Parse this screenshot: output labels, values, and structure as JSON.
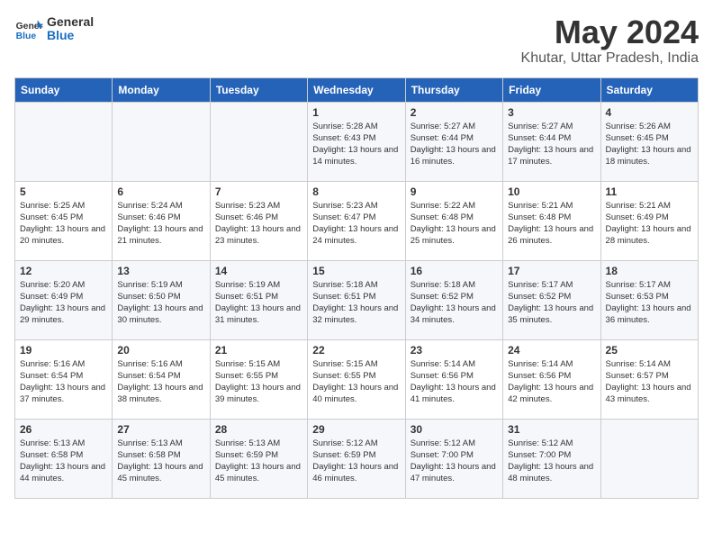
{
  "logo": {
    "text_general": "General",
    "text_blue": "Blue"
  },
  "title": "May 2024",
  "location": "Khutar, Uttar Pradesh, India",
  "headers": [
    "Sunday",
    "Monday",
    "Tuesday",
    "Wednesday",
    "Thursday",
    "Friday",
    "Saturday"
  ],
  "weeks": [
    [
      {
        "day": "",
        "info": ""
      },
      {
        "day": "",
        "info": ""
      },
      {
        "day": "",
        "info": ""
      },
      {
        "day": "1",
        "info": "Sunrise: 5:28 AM\nSunset: 6:43 PM\nDaylight: 13 hours and 14 minutes."
      },
      {
        "day": "2",
        "info": "Sunrise: 5:27 AM\nSunset: 6:44 PM\nDaylight: 13 hours and 16 minutes."
      },
      {
        "day": "3",
        "info": "Sunrise: 5:27 AM\nSunset: 6:44 PM\nDaylight: 13 hours and 17 minutes."
      },
      {
        "day": "4",
        "info": "Sunrise: 5:26 AM\nSunset: 6:45 PM\nDaylight: 13 hours and 18 minutes."
      }
    ],
    [
      {
        "day": "5",
        "info": "Sunrise: 5:25 AM\nSunset: 6:45 PM\nDaylight: 13 hours and 20 minutes."
      },
      {
        "day": "6",
        "info": "Sunrise: 5:24 AM\nSunset: 6:46 PM\nDaylight: 13 hours and 21 minutes."
      },
      {
        "day": "7",
        "info": "Sunrise: 5:23 AM\nSunset: 6:46 PM\nDaylight: 13 hours and 23 minutes."
      },
      {
        "day": "8",
        "info": "Sunrise: 5:23 AM\nSunset: 6:47 PM\nDaylight: 13 hours and 24 minutes."
      },
      {
        "day": "9",
        "info": "Sunrise: 5:22 AM\nSunset: 6:48 PM\nDaylight: 13 hours and 25 minutes."
      },
      {
        "day": "10",
        "info": "Sunrise: 5:21 AM\nSunset: 6:48 PM\nDaylight: 13 hours and 26 minutes."
      },
      {
        "day": "11",
        "info": "Sunrise: 5:21 AM\nSunset: 6:49 PM\nDaylight: 13 hours and 28 minutes."
      }
    ],
    [
      {
        "day": "12",
        "info": "Sunrise: 5:20 AM\nSunset: 6:49 PM\nDaylight: 13 hours and 29 minutes."
      },
      {
        "day": "13",
        "info": "Sunrise: 5:19 AM\nSunset: 6:50 PM\nDaylight: 13 hours and 30 minutes."
      },
      {
        "day": "14",
        "info": "Sunrise: 5:19 AM\nSunset: 6:51 PM\nDaylight: 13 hours and 31 minutes."
      },
      {
        "day": "15",
        "info": "Sunrise: 5:18 AM\nSunset: 6:51 PM\nDaylight: 13 hours and 32 minutes."
      },
      {
        "day": "16",
        "info": "Sunrise: 5:18 AM\nSunset: 6:52 PM\nDaylight: 13 hours and 34 minutes."
      },
      {
        "day": "17",
        "info": "Sunrise: 5:17 AM\nSunset: 6:52 PM\nDaylight: 13 hours and 35 minutes."
      },
      {
        "day": "18",
        "info": "Sunrise: 5:17 AM\nSunset: 6:53 PM\nDaylight: 13 hours and 36 minutes."
      }
    ],
    [
      {
        "day": "19",
        "info": "Sunrise: 5:16 AM\nSunset: 6:54 PM\nDaylight: 13 hours and 37 minutes."
      },
      {
        "day": "20",
        "info": "Sunrise: 5:16 AM\nSunset: 6:54 PM\nDaylight: 13 hours and 38 minutes."
      },
      {
        "day": "21",
        "info": "Sunrise: 5:15 AM\nSunset: 6:55 PM\nDaylight: 13 hours and 39 minutes."
      },
      {
        "day": "22",
        "info": "Sunrise: 5:15 AM\nSunset: 6:55 PM\nDaylight: 13 hours and 40 minutes."
      },
      {
        "day": "23",
        "info": "Sunrise: 5:14 AM\nSunset: 6:56 PM\nDaylight: 13 hours and 41 minutes."
      },
      {
        "day": "24",
        "info": "Sunrise: 5:14 AM\nSunset: 6:56 PM\nDaylight: 13 hours and 42 minutes."
      },
      {
        "day": "25",
        "info": "Sunrise: 5:14 AM\nSunset: 6:57 PM\nDaylight: 13 hours and 43 minutes."
      }
    ],
    [
      {
        "day": "26",
        "info": "Sunrise: 5:13 AM\nSunset: 6:58 PM\nDaylight: 13 hours and 44 minutes."
      },
      {
        "day": "27",
        "info": "Sunrise: 5:13 AM\nSunset: 6:58 PM\nDaylight: 13 hours and 45 minutes."
      },
      {
        "day": "28",
        "info": "Sunrise: 5:13 AM\nSunset: 6:59 PM\nDaylight: 13 hours and 45 minutes."
      },
      {
        "day": "29",
        "info": "Sunrise: 5:12 AM\nSunset: 6:59 PM\nDaylight: 13 hours and 46 minutes."
      },
      {
        "day": "30",
        "info": "Sunrise: 5:12 AM\nSunset: 7:00 PM\nDaylight: 13 hours and 47 minutes."
      },
      {
        "day": "31",
        "info": "Sunrise: 5:12 AM\nSunset: 7:00 PM\nDaylight: 13 hours and 48 minutes."
      },
      {
        "day": "",
        "info": ""
      }
    ]
  ]
}
